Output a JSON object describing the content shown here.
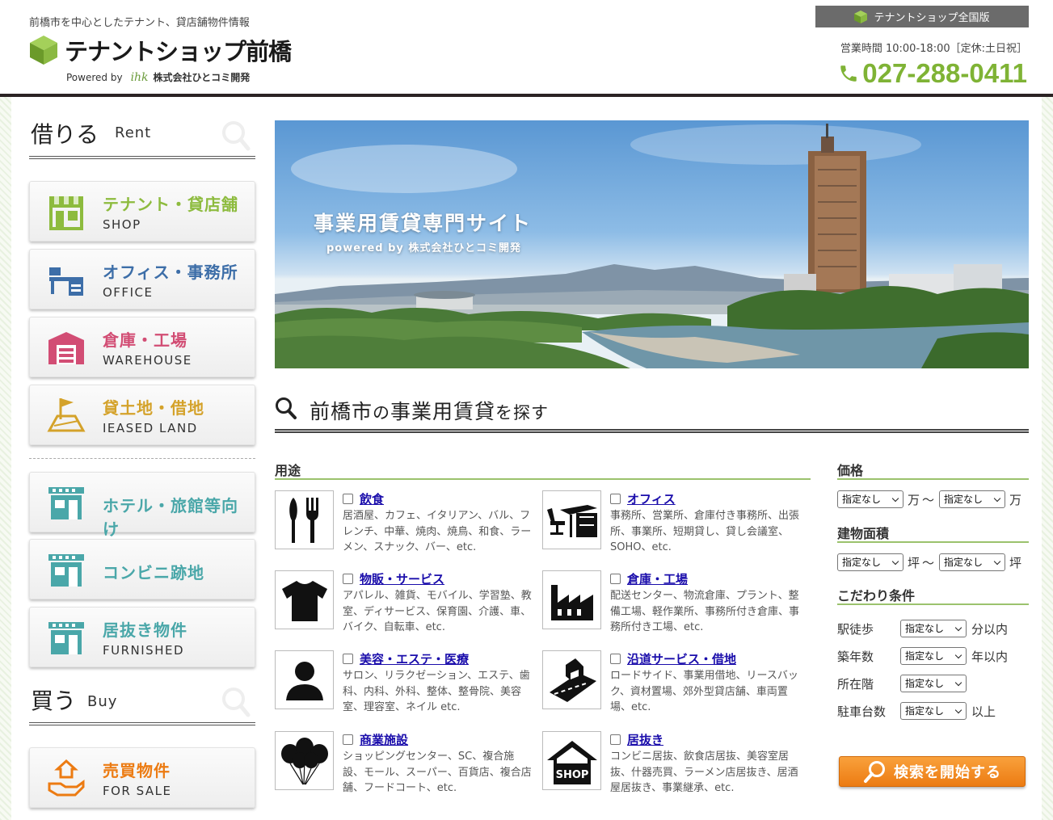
{
  "header": {
    "tagline": "前橋市を中心としたテナント、貸店舗物件情報",
    "logo_text": "テナントショップ前橋",
    "powered_by": "Powered by",
    "powered_mark": "ihk",
    "company": "株式会社ひとコミ開発",
    "national_label": "テナントショップ全国版",
    "hours": "営業時間 10:00-18:00［定休:土日祝］",
    "phone": "027-288-0411",
    "accent": "#7fb335"
  },
  "sidebar": {
    "rent_heading": "借りる",
    "rent_heading_en": "Rent",
    "buy_heading": "買う",
    "buy_heading_en": "Buy",
    "items": [
      {
        "label": "テナント・貸店舗",
        "en": "SHOP",
        "color": "#8dbb3e",
        "icon": "shop-icon"
      },
      {
        "label": "オフィス・事務所",
        "en": "OFFICE",
        "color": "#3d6ea8",
        "icon": "office-icon"
      },
      {
        "label": "倉庫・工場",
        "en": "WAREHOUSE",
        "color": "#d24d74",
        "icon": "warehouse-icon"
      },
      {
        "label": "貸土地・借地",
        "en": "IEASED LAND",
        "color": "#d4a22a",
        "icon": "land-icon"
      },
      {
        "label": "ホテル・旅館等向け",
        "en": "",
        "color": "#4aa7a9",
        "icon": "hotel-icon"
      },
      {
        "label": "コンビニ跡地",
        "en": "",
        "color": "#4aa7a9",
        "icon": "convenience-store-icon"
      },
      {
        "label": "居抜き物件",
        "en": "FURNISHED",
        "color": "#4aa7a9",
        "icon": "furnished-icon"
      },
      {
        "label": "売買物件",
        "en": "FOR SALE",
        "color": "#ec7b12",
        "icon": "for-sale-icon"
      }
    ]
  },
  "hero": {
    "title": "事業用賃貸専門サイト",
    "subtitle": "powered by 株式会社ひとコミ開発"
  },
  "search": {
    "title_part1": "前橋市",
    "title_part2": "の",
    "title_part3": "事業用賃貸",
    "title_part4": "を探す",
    "use_label": "用途",
    "uses": [
      {
        "name": "飲食",
        "desc": "居酒屋、カフェ、イタリアン、バル、フレンチ、中華、焼肉、焼鳥、和食、ラーメン、スナック、バー、etc.",
        "icon": "fork-knife-icon"
      },
      {
        "name": "オフィス",
        "desc": "事務所、営業所、倉庫付き事務所、出張所、事業所、短期貸し、貸し会議室、SOHO、etc.",
        "icon": "office-desk-icon"
      },
      {
        "name": "物販・サービス",
        "desc": "アパレル、雑貨、モバイル、学習塾、教室、ディサービス、保育園、介護、車、バイク、自転車、etc.",
        "icon": "tshirt-icon"
      },
      {
        "name": "倉庫・工場",
        "desc": "配送センター、物流倉庫、プラント、整備工場、軽作業所、事務所付き倉庫、事務所付き工場、etc.",
        "icon": "factory-icon"
      },
      {
        "name": "美容・エステ・医療",
        "desc": "サロン、リラクゼーション、エステ、歯科、内科、外科、整体、整骨院、美容室、理容室、ネイル etc.",
        "icon": "person-icon"
      },
      {
        "name": "沿道サービス・借地",
        "desc": "ロードサイド、事業用借地、リースバック、資材置場、郊外型貸店舗、車両置場、etc.",
        "icon": "roadside-icon"
      },
      {
        "name": "商業施設",
        "desc": "ショッピングセンター、SC、複合施設、モール、スーパー、百貨店、複合店舗、フードコート、etc.",
        "icon": "balloons-icon"
      },
      {
        "name": "居抜き",
        "desc": "コンビニ居抜、飲食店居抜、美容室居抜、什器売買、ラーメン店居抜き、居酒屋居抜き、事業継承、etc.",
        "icon": "shop-house-icon"
      }
    ]
  },
  "filters": {
    "price_label": "価格",
    "area_label": "建物面積",
    "cond_label": "こだわり条件",
    "unset": "指定なし",
    "man": "万",
    "tsubo": "坪",
    "tilde": "～",
    "conditions": [
      {
        "label": "駅徒歩",
        "unit": "分以内"
      },
      {
        "label": "築年数",
        "unit": "年以内"
      },
      {
        "label": "所在階",
        "unit": ""
      },
      {
        "label": "駐車台数",
        "unit": "以上"
      }
    ],
    "search_button": "検索を開始する"
  }
}
